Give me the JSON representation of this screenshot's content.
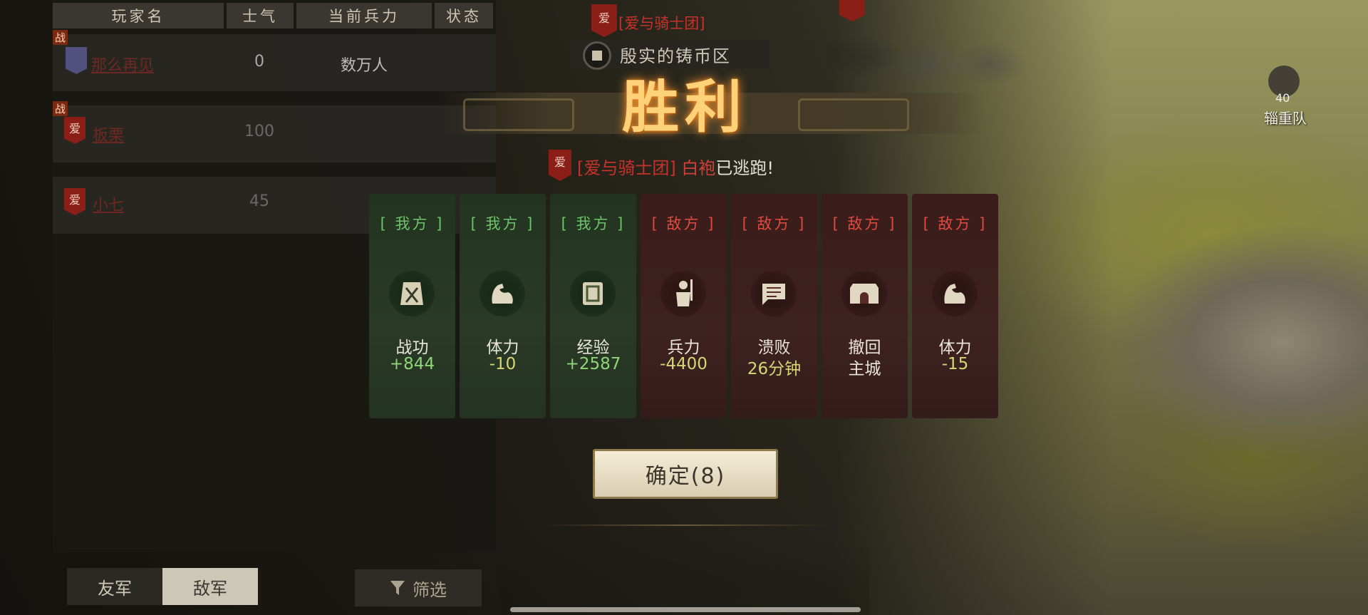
{
  "table": {
    "headers": [
      "玩家名",
      "士气",
      "当前兵力",
      "状态"
    ],
    "rows": [
      {
        "badge": "战",
        "flag": "",
        "name": "那么再见",
        "morale": "0",
        "troops": "数万人"
      },
      {
        "badge": "战",
        "flag": "爱",
        "name": "板栗",
        "morale": "100",
        "troops": ""
      },
      {
        "badge": "",
        "flag": "爱",
        "name": "小七",
        "morale": "45",
        "troops": ""
      }
    ]
  },
  "tabs": {
    "friendly": "友军",
    "enemy": "敌军"
  },
  "filter_label": "筛选",
  "top": {
    "flag": "爱",
    "guild": "[爱与骑士团]",
    "region": "殷实的铸币区"
  },
  "victory_title": "胜利",
  "escape": {
    "flag": "爱",
    "guild": "[爱与骑士团]",
    "name": "白袍",
    "text": "已逃跑!"
  },
  "cards": [
    {
      "side": "[ 我方 ]",
      "icon": "merit-icon",
      "label": "战功",
      "value": "+844"
    },
    {
      "side": "[ 我方 ]",
      "icon": "stamina-icon",
      "label": "体力",
      "value": "-10"
    },
    {
      "side": "[ 我方 ]",
      "icon": "exp-icon",
      "label": "经验",
      "value": "+2587"
    },
    {
      "side": "[ 敌方 ]",
      "icon": "soldier-icon",
      "label": "兵力",
      "value": "-4400"
    },
    {
      "side": "[ 敌方 ]",
      "icon": "rout-flag-icon",
      "label": "溃败",
      "value": "26分钟"
    },
    {
      "side": "[ 敌方 ]",
      "icon": "city-gate-icon",
      "label": "撤回",
      "value": "主城"
    },
    {
      "side": "[ 敌方 ]",
      "icon": "stamina-icon",
      "label": "体力",
      "value": "-15"
    }
  ],
  "confirm_label": "确定(8)",
  "supply": {
    "level": "40",
    "label": "辎重队"
  },
  "colors": {
    "ally": "#6ec46a",
    "enemy": "#e04a40",
    "gold": "#ffd27a",
    "value_yellow": "#d6d672"
  }
}
